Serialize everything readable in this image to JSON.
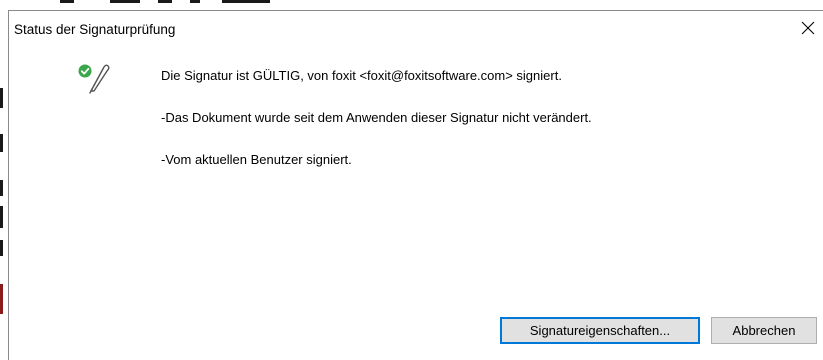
{
  "dialog": {
    "title": "Status der Signaturprüfung",
    "close_icon": "close-icon",
    "status_icon": "signature-valid-icon"
  },
  "messages": {
    "line1": "Die Signatur ist GÜLTIG, von foxit <foxit@foxitsoftware.com> signiert.",
    "line2": "-Das Dokument wurde seit dem Anwenden dieser Signatur nicht verändert.",
    "line3": "-Vom aktuellen Benutzer signiert."
  },
  "buttons": {
    "properties_label": "Signatureigenschaften...",
    "cancel_label": "Abbrechen"
  },
  "colors": {
    "check_green": "#3aa84a",
    "focus_blue": "#0078d7",
    "button_bg": "#e1e1e1"
  }
}
